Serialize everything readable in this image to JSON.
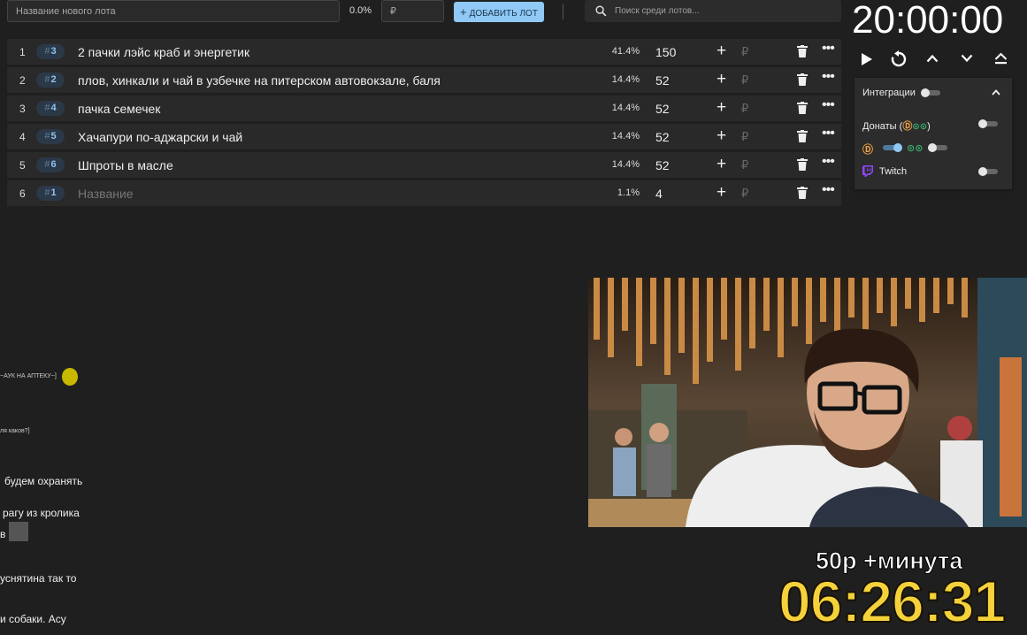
{
  "new_lot": {
    "name_placeholder": "Название нового лота",
    "percent": "0.0%",
    "amount_placeholder": "₽",
    "add_button": "ДОБАВИТЬ ЛОТ",
    "add_button_icon": "plus-icon"
  },
  "search": {
    "placeholder": "Поиск среди лотов..."
  },
  "lots": [
    {
      "index": "1",
      "badge": "3",
      "title": "2 пачки лэйс краб и энергетик",
      "percent": "41.4%",
      "amount": "150",
      "currency": "₽",
      "is_placeholder": false
    },
    {
      "index": "2",
      "badge": "2",
      "title": "плов, хинкали и чай в узбечке на питерском автовокзале, баля",
      "percent": "14.4%",
      "amount": "52",
      "currency": "₽",
      "is_placeholder": false
    },
    {
      "index": "3",
      "badge": "4",
      "title": "пачка семечек",
      "percent": "14.4%",
      "amount": "52",
      "currency": "₽",
      "is_placeholder": false
    },
    {
      "index": "4",
      "badge": "5",
      "title": "Хачапури по-аджарски и чай",
      "percent": "14.4%",
      "amount": "52",
      "currency": "₽",
      "is_placeholder": false
    },
    {
      "index": "5",
      "badge": "6",
      "title": "Шпроты в масле",
      "percent": "14.4%",
      "amount": "52",
      "currency": "₽",
      "is_placeholder": false
    },
    {
      "index": "6",
      "badge": "1",
      "title": "Название",
      "percent": "1.1%",
      "amount": "4",
      "currency": "₽",
      "is_placeholder": true
    }
  ],
  "lot_symbols": {
    "hash": "#",
    "add": "+",
    "more": "•••"
  },
  "timer": {
    "value": "20:00:00",
    "controls": [
      "play-icon",
      "restart-icon",
      "chevron-up-icon",
      "chevron-down-icon",
      "eject-icon"
    ]
  },
  "integrations": {
    "title": "Интеграции",
    "title_toggle_on": false,
    "donations_label": "Донаты (",
    "donations_close": ")",
    "donations_icons": [
      "donationalerts-icon",
      "donatepay-icon"
    ],
    "donations_toggle_on": false,
    "da_toggle_on": true,
    "dp_toggle_on": false,
    "twitch_label": "Twitch",
    "twitch_toggle_on": false,
    "donatepay_glyph": "⊙⊙",
    "da_glyph": "Ⓓ"
  },
  "chat": [
    {
      "text": "~АУК НА АПТЕКУ~]",
      "size": "small"
    },
    {
      "text": "ля каков?]",
      "size": "small"
    },
    {
      "text": "будем охранять",
      "size": "normal"
    },
    {
      "text": "рагу из кролика",
      "size": "normal"
    },
    {
      "text": "в",
      "size": "normal"
    },
    {
      "text": "уснятина так то",
      "size": "normal"
    },
    {
      "text": "и собаки. Асу",
      "size": "normal"
    }
  ],
  "overlay": {
    "offer": "50р +минута",
    "countdown": "06:26:31"
  },
  "colors": {
    "accent": "#90c8f6",
    "badge_text": "#8fc3ef",
    "countdown": "#f5d23b",
    "donationalerts": "#f3a446",
    "donatepay": "#39b36e",
    "twitch": "#9146ff"
  }
}
